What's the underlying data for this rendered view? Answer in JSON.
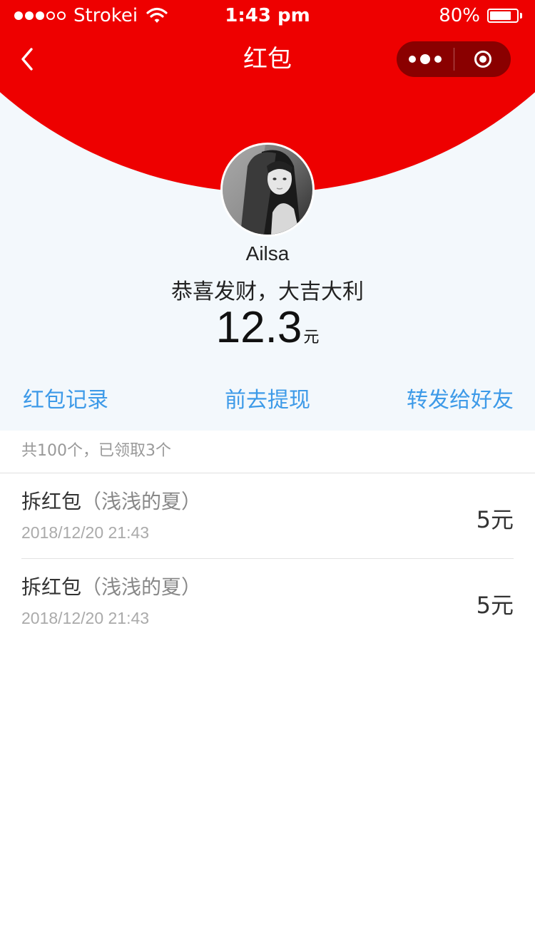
{
  "status_bar": {
    "carrier": "Strokei",
    "time": "1:43 pm",
    "battery_percent": "80%",
    "battery_level": 0.8,
    "signal_full": 3,
    "signal_total": 5
  },
  "nav": {
    "title": "红包",
    "back_icon": "chevron-left-icon",
    "more_icon": "more-dots-icon",
    "close_icon": "target-close-icon"
  },
  "colors": {
    "header_red": "#ee0000",
    "capsule": "#8a0000",
    "link_blue": "#3d9ae8",
    "page_bg": "#f3f8fc"
  },
  "profile": {
    "name": "Ailsa",
    "greeting": "恭喜发财，大吉大利",
    "amount": "12.3",
    "amount_unit": "元"
  },
  "actions": {
    "record": "红包记录",
    "withdraw": "前去提现",
    "forward": "转发给好友"
  },
  "summary": "共100个，已领取3个",
  "records": [
    {
      "title": "拆红包",
      "from": "（浅浅的夏）",
      "time": "2018/12/20 21:43",
      "amount": "5元"
    },
    {
      "title": "拆红包",
      "from": "（浅浅的夏）",
      "time": "2018/12/20 21:43",
      "amount": "5元"
    }
  ]
}
